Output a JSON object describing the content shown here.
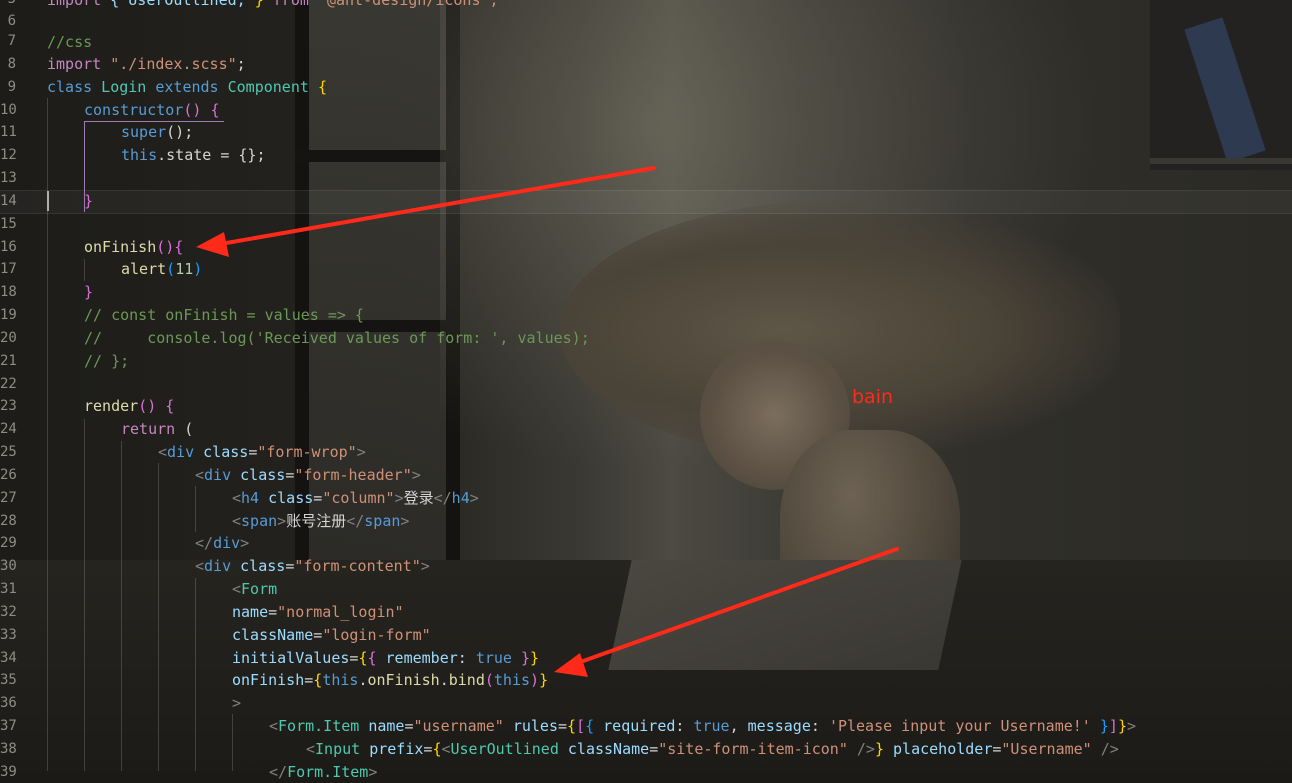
{
  "editor": {
    "language": "javascript-jsx",
    "line_numbers": [
      "5",
      "6",
      "7",
      "8",
      "9",
      "10",
      "11",
      "12",
      "13",
      "14",
      "15",
      "16",
      "17",
      "18",
      "19",
      "20",
      "21",
      "22",
      "23",
      "24",
      "25",
      "26",
      "27",
      "28",
      "29",
      "30",
      "31",
      "32",
      "33",
      "34",
      "35",
      "36",
      "37",
      "38",
      "39"
    ],
    "lines": {
      "l5": {
        "kw": "import",
        "a": " { UserOutlined, ",
        "b": "} ",
        "c": "from",
        "d": " '@ant-design/icons';"
      },
      "l7": {
        "comment": "//css"
      },
      "l8": {
        "kw": "import",
        "str": " \"./index.scss\"",
        "end": ";"
      },
      "l9": {
        "kw1": "class",
        "name": " Login ",
        "kw2": "extends",
        "base": " Component ",
        "brace": "{"
      },
      "l10": {
        "fn": "constructor",
        "paren": "() ",
        "brace": "{"
      },
      "l11": {
        "kw": "super",
        "rest": "();"
      },
      "l12": {
        "kw": "this",
        "rest": ".state = {};"
      },
      "l14": {
        "brace": "}"
      },
      "l16": {
        "fn": "onFinish",
        "paren": "(){"
      },
      "l17": {
        "fn": "alert",
        "open": "(",
        "num": "11",
        "close": ")"
      },
      "l18": {
        "brace": "}"
      },
      "l19": {
        "comment": "// const onFinish = values => {"
      },
      "l20": {
        "comment": "//     console.log('Received values of form: ', values);"
      },
      "l21": {
        "comment": "// };"
      },
      "l23": {
        "fn": "render",
        "paren": "() ",
        "brace": "{"
      },
      "l24": {
        "kw": "return",
        "rest": " ("
      },
      "l25": {
        "lt": "<",
        "tag": "div",
        "attr": " class",
        "eq": "=",
        "val": "\"form-wrop\"",
        "gt": ">"
      },
      "l26": {
        "lt": "<",
        "tag": "div",
        "attr": " class",
        "eq": "=",
        "val": "\"form-header\"",
        "gt": ">"
      },
      "l27": {
        "lt": "<",
        "tag": "h4",
        "attr": " class",
        "eq": "=",
        "val": "\"column\"",
        "gt": ">",
        "text": "登录",
        "close_lt": "</",
        "close_tag": "h4",
        "close_gt": ">"
      },
      "l28": {
        "lt": "<",
        "tag": "span",
        "gt": ">",
        "text": "账号注册",
        "close_lt": "</",
        "close_tag": "span",
        "close_gt": ">"
      },
      "l29": {
        "close_lt": "</",
        "close_tag": "div",
        "close_gt": ">"
      },
      "l30": {
        "lt": "<",
        "tag": "div",
        "attr": " class",
        "eq": "=",
        "val": "\"form-content\"",
        "gt": ">"
      },
      "l31": {
        "lt": "<",
        "tag": "Form"
      },
      "l32": {
        "attr": "name",
        "eq": "=",
        "val": "\"normal_login\""
      },
      "l33": {
        "attr": "className",
        "eq": "=",
        "val": "\"login-form\""
      },
      "l34": {
        "attr": "initialValues",
        "eq": "=",
        "b1": "{",
        "b2": "{ ",
        "key": "remember",
        "colon": ": ",
        "bool": "true",
        "b3": " }",
        "b4": "}"
      },
      "l35": {
        "attr": "onFinish",
        "eq": "=",
        "b1": "{",
        "kw": "this",
        "dot": ".",
        "fn1": "onFinish",
        "dot2": ".",
        "fn2": "bind",
        "p1": "(",
        "kw2": "this",
        "p2": ")",
        "b2": "}"
      },
      "l36": {
        "gt": ">"
      },
      "l37": {
        "lt": "<",
        "tag": "Form.Item",
        "attr1": " name",
        "eq1": "=",
        "val1": "\"username\"",
        "attr2": " rules",
        "eq2": "=",
        "b1": "{",
        "b2": "[",
        "b3": "{ ",
        "key1": "required",
        "c1": ": ",
        "bool": "true",
        "comma": ", ",
        "key2": "message",
        "c2": ": ",
        "msg": "'Please input your Username!'",
        "b4": " }",
        "b5": "]",
        "b6": "}",
        "gt": ">"
      },
      "l38": {
        "lt": "<",
        "tag": "Input",
        "attr1": " prefix",
        "eq1": "=",
        "b1": "{",
        "lt2": "<",
        "comp": "UserOutlined",
        "attr2": " className",
        "eq2": "=",
        "val": "\"site-form-item-icon\"",
        "sc": " />",
        "b2": "}",
        "attr3": " placeholder",
        "eq3": "=",
        "val2": "\"Username\"",
        "end": " />"
      },
      "l39": {
        "close_lt": "</",
        "close_tag": "Form.Item",
        "close_gt": ">"
      }
    }
  },
  "annotations": {
    "label": "bain",
    "arrow_color": "#ff2a1a"
  },
  "colors": {
    "keyword": "#c586c0",
    "storage": "#569cd6",
    "class": "#4ec9b0",
    "function": "#dcdcaa",
    "string": "#ce9178",
    "comment": "#6a9955",
    "attribute": "#9cdcfe"
  }
}
